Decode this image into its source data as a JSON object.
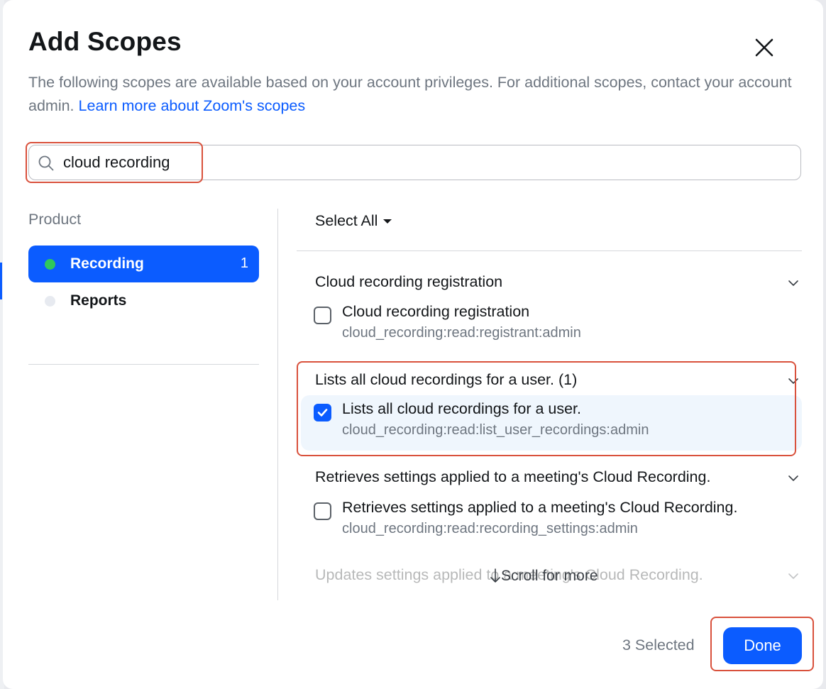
{
  "dialog": {
    "title": "Add Scopes",
    "description": "The following scopes are available based on your account privileges. For additional scopes, contact your account admin.",
    "learn_more_link": "Learn more about Zoom's scopes"
  },
  "search": {
    "value": "cloud recording",
    "placeholder": ""
  },
  "sidebar": {
    "heading": "Product",
    "items": [
      {
        "label": "Recording",
        "count": "1",
        "active": true,
        "dot_color": "#2fc85c"
      },
      {
        "label": "Reports",
        "count": "",
        "active": false,
        "dot_color": "#e7eaf0"
      }
    ]
  },
  "list": {
    "select_all_label": "Select All",
    "groups": [
      {
        "header": "Cloud recording registration",
        "scope": {
          "title": "Cloud recording registration",
          "key": "cloud_recording:read:registrant:admin",
          "checked": false
        }
      },
      {
        "header": "Lists all cloud recordings for a user. (1)",
        "scope": {
          "title": "Lists all cloud recordings for a user.",
          "key": "cloud_recording:read:list_user_recordings:admin",
          "checked": true
        }
      },
      {
        "header": "Retrieves settings applied to a meeting's Cloud Recording.",
        "scope": {
          "title": "Retrieves settings applied to a meeting's Cloud Recording.",
          "key": "cloud_recording:read:recording_settings:admin",
          "checked": false
        }
      },
      {
        "header": "Updates settings applied to a meeting's Cloud Recording."
      }
    ],
    "scroll_hint": "Scroll for more"
  },
  "footer": {
    "selected_text": "3 Selected",
    "done_label": "Done"
  },
  "colors": {
    "primary": "#0b5cff",
    "highlight": "#d9513c",
    "active_dot": "#2fc85c"
  }
}
